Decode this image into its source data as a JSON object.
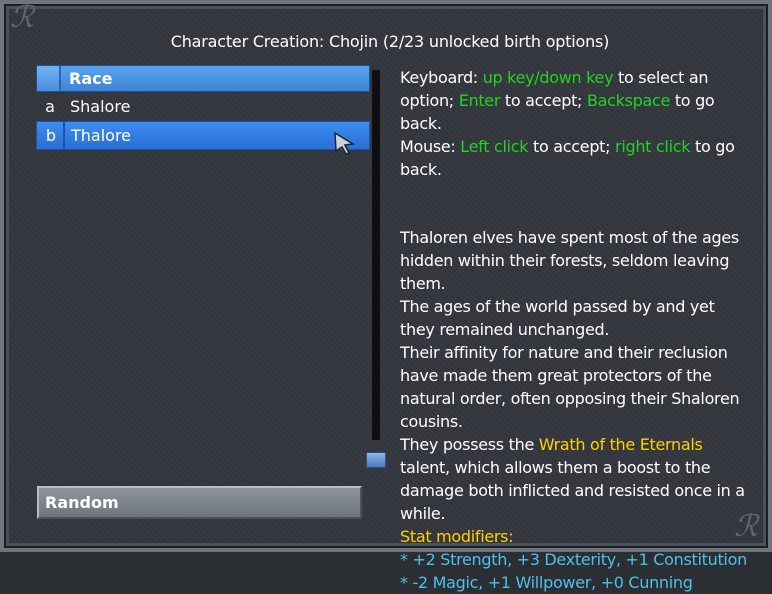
{
  "title": "Character Creation: Chojin (2/23 unlocked birth options)",
  "list": {
    "header": "Race",
    "items": [
      {
        "key": "a",
        "label": "Shalore"
      },
      {
        "key": "b",
        "label": "Thalore"
      }
    ]
  },
  "random_label": "Random",
  "help": {
    "kb_prefix": "Keyboard: ",
    "kb_updown": "up key/down key",
    "kb_select": " to select an option;",
    "enter": "Enter",
    "to_accept1": " to accept; ",
    "backspace": "Backspace",
    "to_go_back1": " to go back.",
    "mouse_prefix": "Mouse: ",
    "left_click": "Left click",
    "to_accept2": " to accept; ",
    "right_click": "right click",
    "to_go_back2": " to go back."
  },
  "description": {
    "line1": "Thaloren elves have spent most of the ages hidden within their forests, seldom leaving them.",
    "line2": "The ages of the world passed by and yet they remained unchanged.",
    "line3": "Their affinity for nature and their reclusion have made them great protectors of the natural order, often opposing their Shaloren cousins.",
    "line4_pre": "They possess the ",
    "talent": "Wrath of the Eternals",
    "line4_post": " talent, which allows them a boost to the damage both inflicted and resisted once in a while.",
    "stat_header": "Stat modifiers:",
    "stat1": " * +2 Strength, +3 Dexterity, +1 Constitution",
    "stat2": " * -2 Magic, +1 Willpower, +0 Cunning"
  },
  "colors": {
    "accent": "#3d8ef0",
    "keyword": "#23d323",
    "highlight": "#ffd100",
    "stat": "#4ec0e8"
  }
}
